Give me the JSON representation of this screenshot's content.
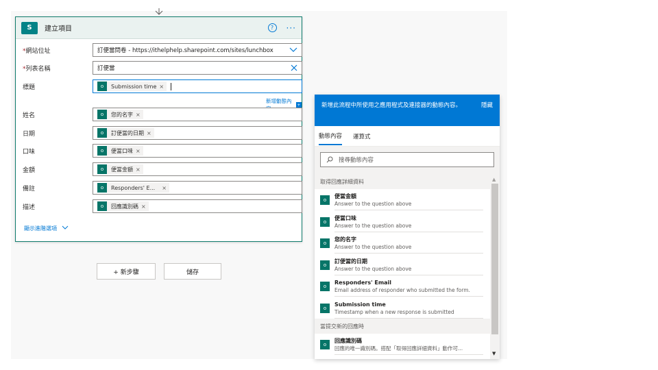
{
  "card": {
    "title": "建立項目",
    "logo": "S",
    "help": "?",
    "more": "···",
    "fields": [
      {
        "label": "網站位址",
        "required": "*",
        "value": "訂便當問卷 - https://ithelphelp.sharepoint.com/sites/lunchbox",
        "trail": "chevron-down-icon"
      },
      {
        "label": "列表名稱",
        "required": "*",
        "value": "訂便當",
        "trail": "clear-icon"
      },
      {
        "label": "標題",
        "required": "",
        "chip": "Submission time"
      },
      {
        "label": "姓名",
        "required": "",
        "chip": "您的名字"
      },
      {
        "label": "日期",
        "required": "",
        "chip": "訂便當的日期"
      },
      {
        "label": "口味",
        "required": "",
        "chip": "便當口味"
      },
      {
        "label": "金額",
        "required": "",
        "chip": "便當金額"
      },
      {
        "label": "備註",
        "required": "",
        "chip": "Responders' E..."
      },
      {
        "label": "描述",
        "required": "",
        "chip": "回應識別碼"
      }
    ],
    "add_dynamic": "新增動態內容",
    "advanced": "顯示進階選項"
  },
  "buttons": {
    "new_step": "+ 新步驟",
    "save": "儲存"
  },
  "panel": {
    "message": "新增此流程中所使用之應用程式及連接器的動態內容。",
    "hide": "隱藏",
    "tabs": [
      "動態內容",
      "運算式"
    ],
    "search_placeholder": "搜尋動態內容",
    "section1": "取得回應詳細資料",
    "items": [
      {
        "name": "便當金額",
        "desc": "Answer to the question above"
      },
      {
        "name": "便當口味",
        "desc": "Answer to the question above"
      },
      {
        "name": "您的名字",
        "desc": "Answer to the question above"
      },
      {
        "name": "訂便當的日期",
        "desc": "Answer to the question above"
      },
      {
        "name": "Responders' Email",
        "desc": "Email address of responder who submitted the form."
      },
      {
        "name": "Submission time",
        "desc": "Timestamp when a new response is submitted"
      }
    ],
    "section2": "當提交新的回應時",
    "items2": [
      {
        "name": "回應識別碼",
        "desc": "回應的唯一識別碼。搭配「取得回應詳細資料」動作可..."
      }
    ]
  },
  "colors": {
    "accent": "#0078d4",
    "connector": "#077568"
  }
}
